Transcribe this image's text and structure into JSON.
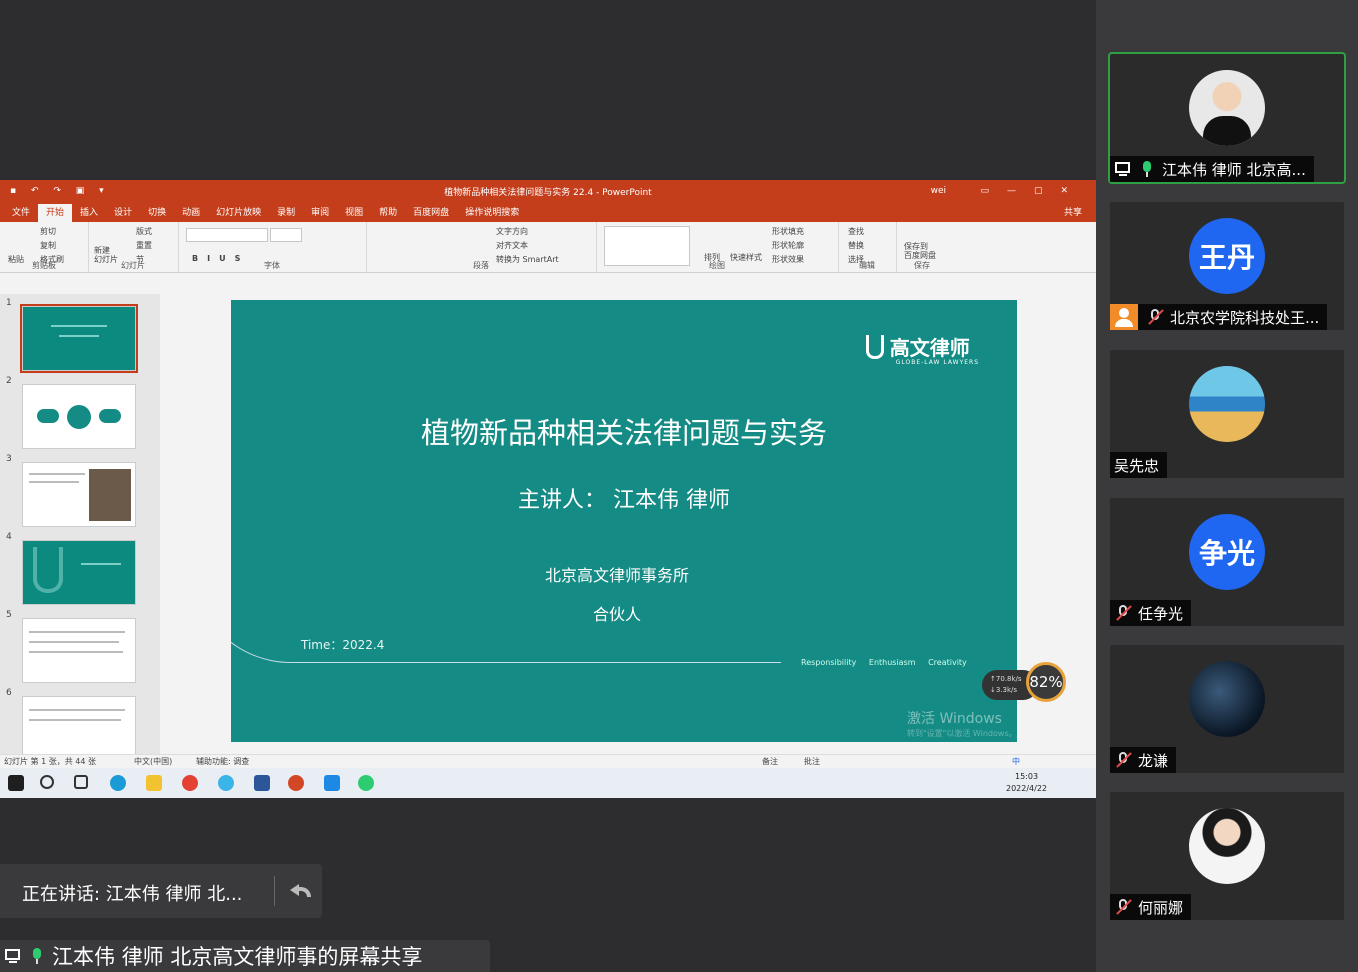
{
  "participants": [
    {
      "name": "江本伟 律师  北京高...",
      "avatar_text": "",
      "avatar": "photo",
      "status_icon": "screen-share-icon",
      "mic": "on",
      "active": true
    },
    {
      "name": "北京农学院科技处王...",
      "avatar_text": "王丹",
      "avatar": "blue",
      "status_icon": "person-icon",
      "mic": "muted",
      "active": false
    },
    {
      "name": "吴先忠",
      "avatar_text": "",
      "avatar": "island",
      "status_icon": "",
      "mic": "none",
      "active": false
    },
    {
      "name": "任争光",
      "avatar_text": "争光",
      "avatar": "blue",
      "status_icon": "",
      "mic": "muted",
      "active": false
    },
    {
      "name": "龙谦",
      "avatar_text": "",
      "avatar": "night",
      "status_icon": "",
      "mic": "muted",
      "active": false
    },
    {
      "name": "何丽娜",
      "avatar_text": "",
      "avatar": "woman",
      "status_icon": "",
      "mic": "muted",
      "active": false
    }
  ],
  "ppt": {
    "window_title": "植物新品种相关法律问题与实务 22.4  -  PowerPoint",
    "user": "wei",
    "tabs": [
      "文件",
      "开始",
      "插入",
      "设计",
      "切换",
      "动画",
      "幻灯片放映",
      "录制",
      "审阅",
      "视图",
      "帮助",
      "百度网盘",
      "操作说明搜索"
    ],
    "selected_tab": "开始",
    "share_label": "共享",
    "ribbon": {
      "paste": "粘贴",
      "cut": "剪切",
      "copy": "复制",
      "format_painter": "格式刷",
      "clipboard": "剪贴板",
      "new_slide": "新建\n幻灯片",
      "layout": "版式",
      "reset": "重置",
      "section": "节",
      "slides": "幻灯片",
      "font": "字体",
      "text_direction": "文字方向",
      "align_text": "对齐文本",
      "smartart": "转换为 SmartArt",
      "paragraph": "段落",
      "arrange": "排列",
      "quick_styles": "快速样式",
      "shape_fill": "形状填充",
      "shape_outline": "形状轮廓",
      "shape_effects": "形状效果",
      "drawing": "绘图",
      "find": "查找",
      "replace": "替换",
      "select": "选择",
      "editing": "编辑",
      "save_to_baidu": "保存到\n百度网盘",
      "save": "保存"
    },
    "thumbnail_numbers": [
      "1",
      "2",
      "3",
      "4",
      "5",
      "6"
    ],
    "slide": {
      "logo_cn": "高文律师",
      "logo_en": "GLOBE-LAW LAWYERS",
      "title": "植物新品种相关法律问题与实务",
      "speaker": "主讲人： 江本伟     律师",
      "firm": "北京高文律师事务所",
      "role": "合伙人",
      "time": "Time：2022.4",
      "tags": "Responsibility  Enthusiasm  Creativity",
      "activate_title": "激活 Windows",
      "activate_sub": "转到\"设置\"以激活 Windows。"
    },
    "status": {
      "slide_info": "幻灯片 第 1 张，共 44 张",
      "language": "中文(中国)",
      "accessibility": "辅助功能: 调查",
      "notes": "备注",
      "comments": "批注"
    },
    "gauge": {
      "up": "↑70.8k/s",
      "down": "↓3.3k/s",
      "percent": "82%"
    },
    "clock": {
      "time": "15:03",
      "date": "2022/4/22"
    },
    "ime": "中"
  },
  "speaking": "正在讲话: 江本伟 律师  北...",
  "share_banner": "江本伟 律师  北京高文律师事的屏幕共享",
  "colors": {
    "ppt_red": "#c43e1c",
    "slide_teal": "#148b84",
    "blue_avatar": "#1f67f0",
    "active_green": "#2ea043"
  }
}
